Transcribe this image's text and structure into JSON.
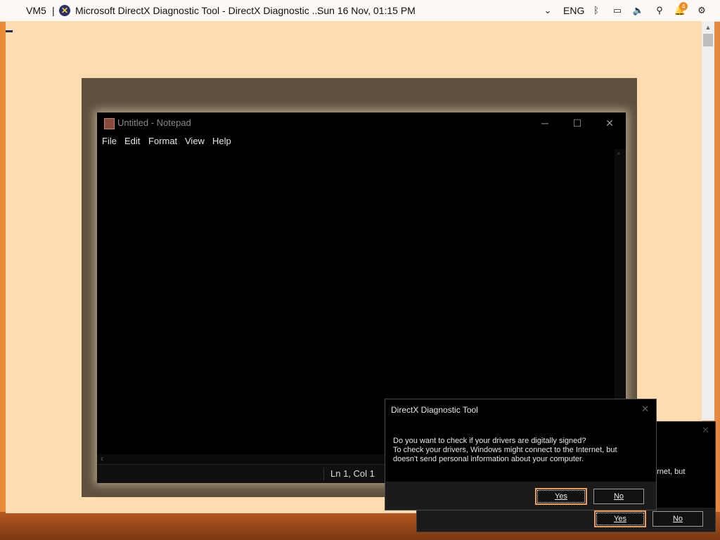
{
  "topbar": {
    "vm_label": "VM5",
    "separator": "|",
    "window_title": "Microsoft DirectX Diagnostic Tool  -  DirectX Diagnostic ...",
    "datetime": "Sun 16 Nov, 01:15 PM",
    "language": "ENG",
    "notification_count": "4",
    "icons": [
      "directx-app-icon",
      "accessibility-icon",
      "bluetooth-icon",
      "display-icon",
      "volume-icon",
      "network-icon",
      "notifications-icon",
      "settings-icon"
    ]
  },
  "notepad": {
    "title": "Untitled - Notepad",
    "minimize": "─",
    "maximize": "☐",
    "close": "✕",
    "menu": [
      "File",
      "Edit",
      "Format",
      "View",
      "Help"
    ],
    "status_position": "Ln 1, Col 1"
  },
  "dialog_main": {
    "title": "DirectX Diagnostic Tool",
    "close": "✕",
    "message_line1": "Do you want to check if your drivers are digitally signed?",
    "message_line2": "To check your drivers, Windows might connect to the Internet, but",
    "message_line3": "doesn't send personal information about your computer.",
    "yes_label": "Yes",
    "no_label": "No"
  },
  "dialog_back": {
    "close": "✕",
    "fragment": "ernet, but",
    "yes_label": "Yes",
    "no_label": "No"
  },
  "colors": {
    "accent_focus": "#f0a050",
    "dialog_bg": "#000000",
    "desktop": "#fbd9ae"
  }
}
